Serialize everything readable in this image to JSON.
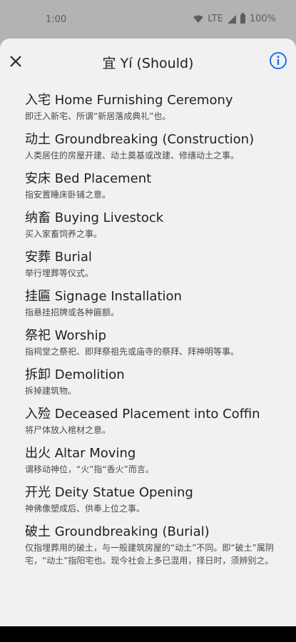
{
  "status": {
    "time": "1:00",
    "network": "LTE",
    "battery": "100%"
  },
  "header": {
    "title": "宜 Yí (Should)",
    "close_icon": "close-icon",
    "info_icon": "info-icon",
    "accent": "#1a73e8"
  },
  "items": [
    {
      "title": "入宅 Home Furnishing Ceremony",
      "desc": "即迁入新宅、所谓“新居落成典礼”也。"
    },
    {
      "title": "动土 Groundbreaking (Construction)",
      "desc": "人类居住的房屋开建、动土奠基或改建、修缮动土之事。"
    },
    {
      "title": "安床 Bed Placement",
      "desc": "指安置睡床卧铺之意。"
    },
    {
      "title": "纳畜 Buying Livestock",
      "desc": "买入家畜饲养之事。"
    },
    {
      "title": "安葬 Burial",
      "desc": "举行埋葬等仪式。"
    },
    {
      "title": "挂匾 Signage Installation",
      "desc": "指悬挂招牌或各种匾额。"
    },
    {
      "title": "祭祀 Worship",
      "desc": "指祠堂之祭祀、即拜祭祖先或庙寺的祭拜、拜神明等事。"
    },
    {
      "title": "拆卸 Demolition",
      "desc": "拆掉建筑物。"
    },
    {
      "title": "入殓 Deceased Placement into Coffin",
      "desc": "将尸体放入棺材之意。"
    },
    {
      "title": "出火 Altar Moving",
      "desc": "谓移动神位，“火”指“香火”而言。"
    },
    {
      "title": "开光 Deity Statue Opening",
      "desc": "神佛像塑成后、供奉上位之事。"
    },
    {
      "title": "破土 Groundbreaking (Burial)",
      "desc": "仅指埋葬用的破土，与一般建筑房屋的“动土”不同。即“破土”属阴宅，“动土”指阳宅也。现今社会上多已混用，择日时，须辨别之。"
    }
  ]
}
